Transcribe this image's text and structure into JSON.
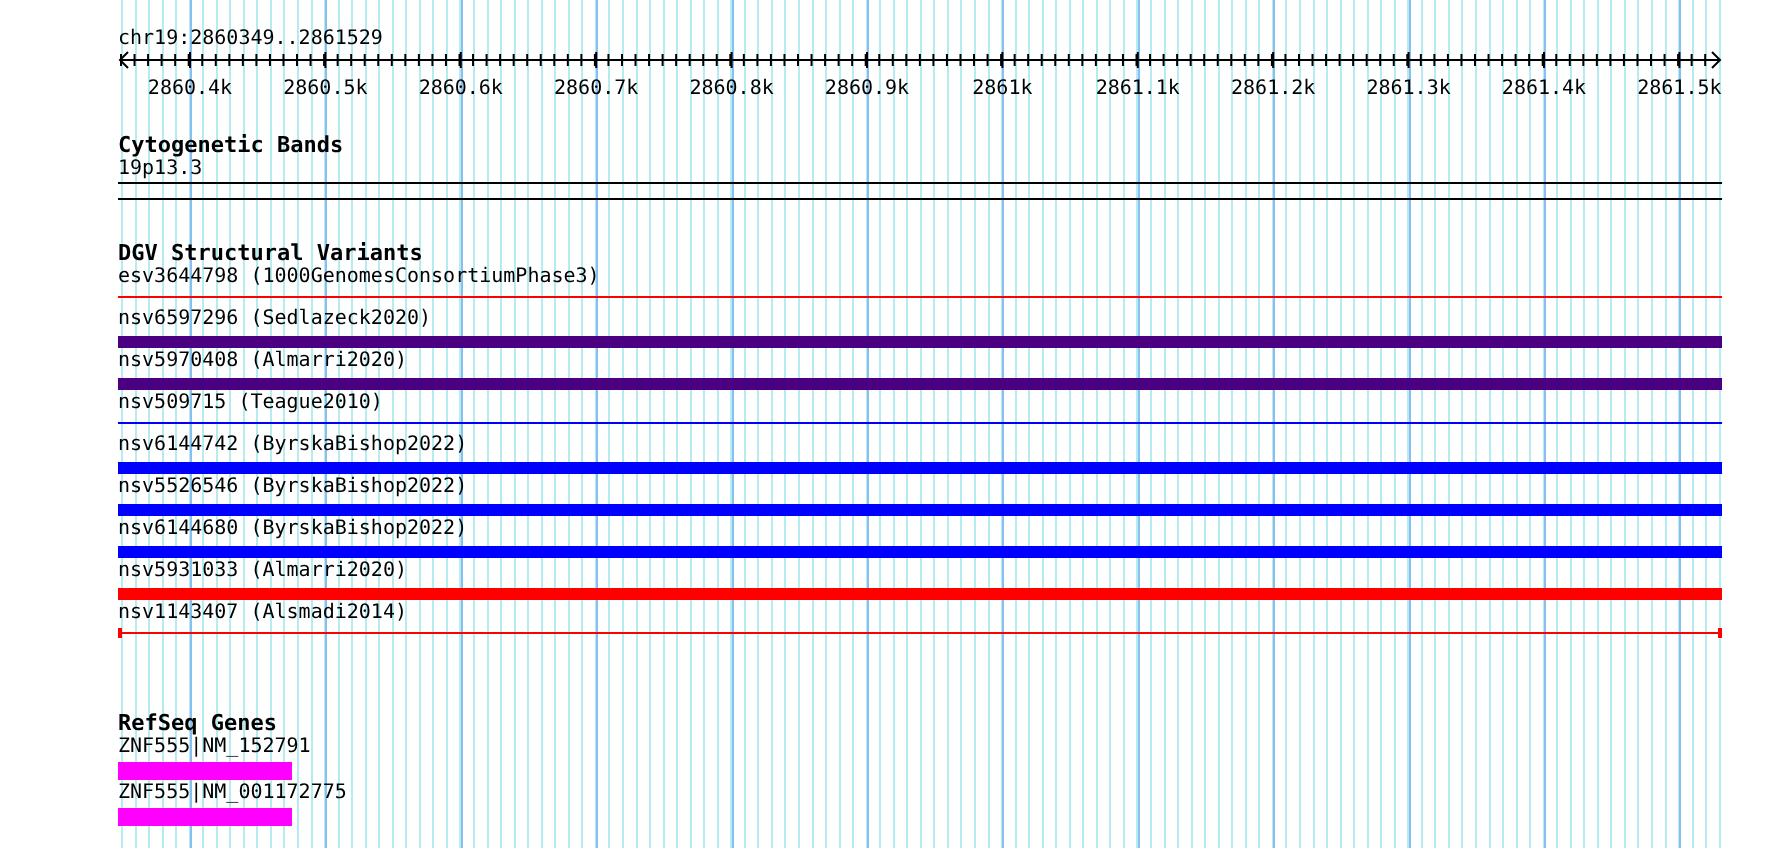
{
  "location": "chr19:2860349..2861529",
  "ruler": {
    "labels": [
      "2860.4k",
      "2860.5k",
      "2860.6k",
      "2860.7k",
      "2860.8k",
      "2860.9k",
      "2861k",
      "2861.1k",
      "2861.2k",
      "2861.3k",
      "2861.4k",
      "2861.5k"
    ]
  },
  "tracks": [
    {
      "kind": "cytoband",
      "title": "Cytogenetic Bands",
      "features": [
        {
          "name": "19p13.3"
        }
      ]
    },
    {
      "kind": "variants",
      "title": "DGV Structural Variants",
      "features": [
        {
          "name": "esv3644798 (1000GenomesConsortiumPhase3)",
          "kind": "thin",
          "color": "#ff0000"
        },
        {
          "name": "nsv6597296 (Sedlazeck2020)",
          "kind": "thick",
          "color": "#4b0082"
        },
        {
          "name": "nsv5970408 (Almarri2020)",
          "kind": "thick",
          "color": "#4b0082"
        },
        {
          "name": "nsv509715 (Teague2010)",
          "kind": "thin",
          "color": "#0000ff"
        },
        {
          "name": "nsv6144742 (ByrskaBishop2022)",
          "kind": "thick",
          "color": "#0000ff"
        },
        {
          "name": "nsv5526546 (ByrskaBishop2022)",
          "kind": "thick",
          "color": "#0000ff"
        },
        {
          "name": "nsv6144680 (ByrskaBishop2022)",
          "kind": "thick",
          "color": "#0000ff"
        },
        {
          "name": "nsv5931033 (Almarri2020)",
          "kind": "thick",
          "color": "#ff0000"
        },
        {
          "name": "nsv1143407 (Alsmadi2014)",
          "kind": "span",
          "color": "#ff0000"
        }
      ]
    },
    {
      "kind": "genes",
      "title": "RefSeq Genes",
      "features": [
        {
          "name": "ZNF555|NM_152791",
          "level": 0.108
        },
        {
          "name": "ZNF555|NM_001172775",
          "level": 0.108
        }
      ]
    }
  ]
}
